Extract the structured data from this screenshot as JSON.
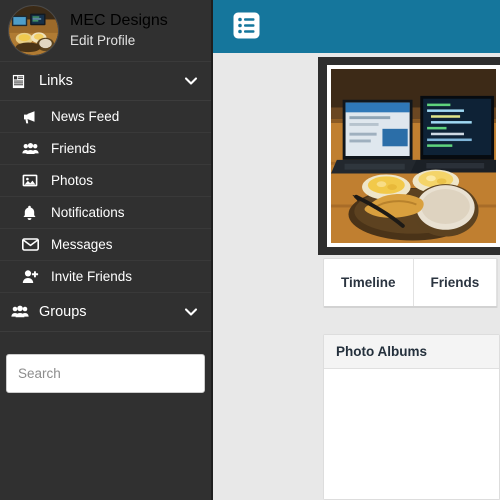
{
  "sidebar": {
    "profile": {
      "avatar_icon": "user-avatar-photo",
      "name": "MEC Designs",
      "edit_link": "Edit Profile"
    },
    "links_section": {
      "icon": "links-book-icon",
      "label": "Links",
      "chevron_icon": "chevron-down-icon"
    },
    "items": [
      {
        "label": "News Feed",
        "icon": "megaphone-icon"
      },
      {
        "label": "Friends",
        "icon": "users-group-icon"
      },
      {
        "label": "Photos",
        "icon": "photo-image-icon"
      },
      {
        "label": "Notifications",
        "icon": "bell-icon"
      },
      {
        "label": "Messages",
        "icon": "envelope-icon"
      },
      {
        "label": "Invite Friends",
        "icon": "user-plus-icon"
      }
    ],
    "groups_section": {
      "icon": "users-group-icon",
      "label": "Groups",
      "chevron_icon": "chevron-down-icon"
    },
    "search": {
      "placeholder": "Search",
      "value": "",
      "icon": "search-input"
    },
    "colors": {
      "background": "#303030",
      "text": "#ffffff"
    }
  },
  "topbar": {
    "menu_icon": "list-menu-icon",
    "color": "#15769c"
  },
  "main": {
    "cover_photo": {
      "icon": "cover-photo-laptops-food",
      "alt": "Two laptops and plates of food on a wooden table"
    },
    "tabs": [
      {
        "label": "Timeline",
        "active": true
      },
      {
        "label": "Friends",
        "active": false
      }
    ],
    "photo_albums": {
      "title": "Photo Albums",
      "items": []
    },
    "colors": {
      "background": "#e8e8e8",
      "panel": "#ffffff"
    }
  }
}
